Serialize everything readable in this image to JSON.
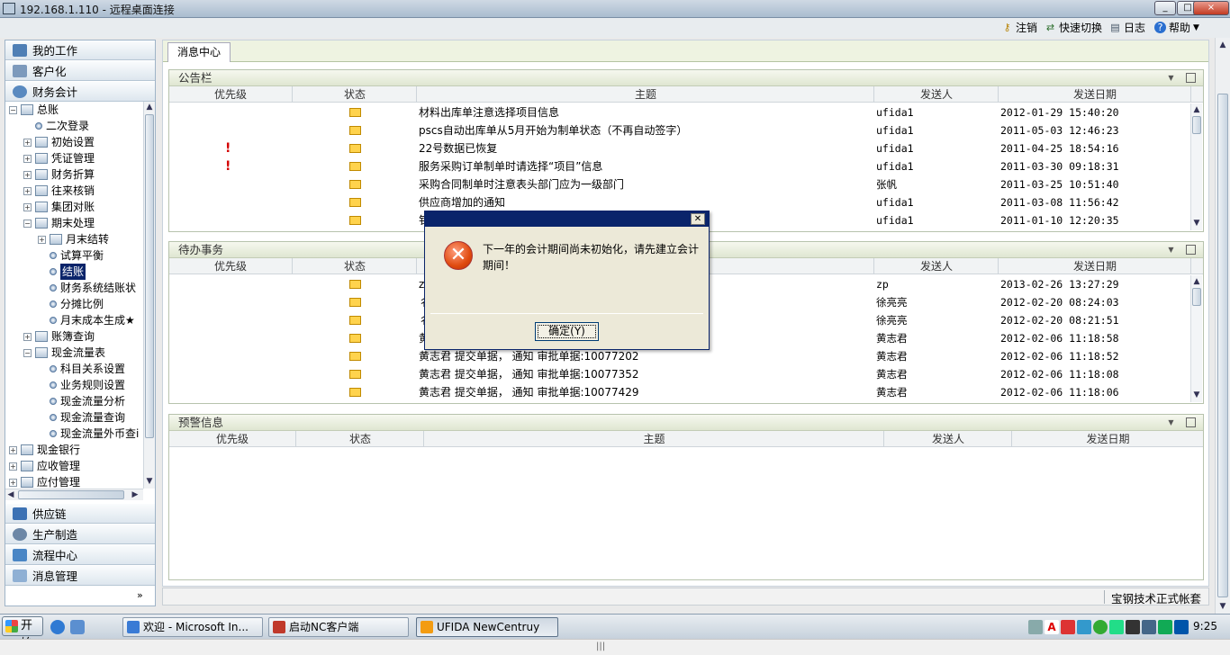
{
  "window": {
    "title": "192.168.1.110 - 远程桌面连接",
    "controls": [
      "_",
      "□",
      "×"
    ]
  },
  "toolbar": {
    "logout": "注销",
    "quick_switch": "快速切换",
    "log": "日志",
    "help": "帮助"
  },
  "nav": {
    "sections_top": [
      {
        "label": "我的工作",
        "icon": "computer-icon"
      },
      {
        "label": "客户化",
        "icon": "window-icon"
      },
      {
        "label": "财务会计",
        "icon": "person-icon"
      }
    ],
    "tree": [
      {
        "label": "总账",
        "level": 0,
        "expander": "−",
        "kind": "folder"
      },
      {
        "label": "二次登录",
        "level": 1,
        "expander": "",
        "kind": "leaf"
      },
      {
        "label": "初始设置",
        "level": 1,
        "expander": "+",
        "kind": "folder"
      },
      {
        "label": "凭证管理",
        "level": 1,
        "expander": "+",
        "kind": "folder"
      },
      {
        "label": "财务折算",
        "level": 1,
        "expander": "+",
        "kind": "folder"
      },
      {
        "label": "往来核销",
        "level": 1,
        "expander": "+",
        "kind": "folder"
      },
      {
        "label": "集团对账",
        "level": 1,
        "expander": "+",
        "kind": "folder"
      },
      {
        "label": "期末处理",
        "level": 1,
        "expander": "−",
        "kind": "folder"
      },
      {
        "label": "月末结转",
        "level": 2,
        "expander": "+",
        "kind": "folder"
      },
      {
        "label": "试算平衡",
        "level": 2,
        "expander": "",
        "kind": "leaf"
      },
      {
        "label": "结账",
        "level": 2,
        "expander": "",
        "kind": "leaf",
        "selected": true
      },
      {
        "label": "财务系统结账状",
        "level": 2,
        "expander": "",
        "kind": "leaf"
      },
      {
        "label": "分摊比例",
        "level": 2,
        "expander": "",
        "kind": "leaf"
      },
      {
        "label": "月末成本生成★",
        "level": 2,
        "expander": "",
        "kind": "leaf"
      },
      {
        "label": "账簿查询",
        "level": 1,
        "expander": "+",
        "kind": "folder"
      },
      {
        "label": "现金流量表",
        "level": 1,
        "expander": "−",
        "kind": "folder"
      },
      {
        "label": "科目关系设置",
        "level": 2,
        "expander": "",
        "kind": "leaf"
      },
      {
        "label": "业务规则设置",
        "level": 2,
        "expander": "",
        "kind": "leaf"
      },
      {
        "label": "现金流量分析",
        "level": 2,
        "expander": "",
        "kind": "leaf"
      },
      {
        "label": "现金流量查询",
        "level": 2,
        "expander": "",
        "kind": "leaf"
      },
      {
        "label": "现金流量外币查i",
        "level": 2,
        "expander": "",
        "kind": "leaf"
      },
      {
        "label": "现金银行",
        "level": 0,
        "expander": "+",
        "kind": "folder"
      },
      {
        "label": "应收管理",
        "level": 0,
        "expander": "+",
        "kind": "folder"
      },
      {
        "label": "应付管理",
        "level": 0,
        "expander": "+",
        "kind": "folder"
      }
    ],
    "sections_bottom": [
      {
        "label": "供应链",
        "icon": "supply-chain-icon"
      },
      {
        "label": "生产制造",
        "icon": "gear-icon"
      },
      {
        "label": "流程中心",
        "icon": "flow-icon"
      },
      {
        "label": "消息管理",
        "icon": "envelope-icon"
      }
    ],
    "collapse_glyph": "»"
  },
  "tab": {
    "label": "消息中心"
  },
  "columns": {
    "priority": "优先级",
    "status": "状态",
    "subject": "主题",
    "sender": "发送人",
    "date": "发送日期"
  },
  "bulletin": {
    "title": "公告栏",
    "rows": [
      {
        "priority": "",
        "subject": "材料出库单注意选择项目信息",
        "sender": "ufida1",
        "date": "2012-01-29 15:40:20"
      },
      {
        "priority": "",
        "subject": "pscs自动出库单从5月开始为制单状态（不再自动签字）",
        "sender": "ufida1",
        "date": "2011-05-03 12:46:23"
      },
      {
        "priority": "!",
        "subject": "22号数据已恢复",
        "sender": "ufida1",
        "date": "2011-04-25 18:54:16"
      },
      {
        "priority": "!",
        "subject": "服务采购订单制单时请选择“项目”信息",
        "sender": "ufida1",
        "date": "2011-03-30 09:18:31"
      },
      {
        "priority": "",
        "subject": "采购合同制单时注意表头部门应为一级部门",
        "sender": "张帆",
        "date": "2011-03-25 10:51:40"
      },
      {
        "priority": "",
        "subject": "供应商增加的通知",
        "sender": "ufida1",
        "date": "2011-03-08 11:56:42"
      },
      {
        "priority": "",
        "subject": "钅",
        "sender": "ufida1",
        "date": "2011-01-10 12:20:35"
      }
    ]
  },
  "todo": {
    "title": "待办事务",
    "rows": [
      {
        "priority": "",
        "subject": "z",
        "sender": "zp",
        "date": "2013-02-26 13:27:29"
      },
      {
        "priority": "",
        "subject": "彳",
        "sender": "徐亮亮",
        "date": "2012-02-20 08:24:03"
      },
      {
        "priority": "",
        "subject": "彳",
        "sender": "徐亮亮",
        "date": "2012-02-20 08:21:51"
      },
      {
        "priority": "",
        "subject": "黄",
        "sender": "黄志君",
        "date": "2012-02-06 11:18:58"
      },
      {
        "priority": "",
        "subject": "黄志君 提交单据， 通知 审批单据:10077202",
        "sender": "黄志君",
        "date": "2012-02-06 11:18:52"
      },
      {
        "priority": "",
        "subject": "黄志君 提交单据， 通知 审批单据:10077352",
        "sender": "黄志君",
        "date": "2012-02-06 11:18:08"
      },
      {
        "priority": "",
        "subject": "黄志君 提交单据， 通知 审批单据:10077429",
        "sender": "黄志君",
        "date": "2012-02-06 11:18:06"
      }
    ]
  },
  "warning": {
    "title": "预警信息",
    "rows": []
  },
  "status_bar": {
    "account": "宝钢技术正式帐套"
  },
  "dialog": {
    "close_glyph": "✕",
    "icon_glyph": "✕",
    "message": "下一年的会计期间尚未初始化，请先建立会计期间！",
    "ok_label": "确定(Y)"
  },
  "taskbar": {
    "start": "开始",
    "tasks": [
      {
        "label": "欢迎 - Microsoft In...",
        "icon_color": "#3a7bd5"
      },
      {
        "label": "启动NC客户端",
        "icon_color": "#c0392b"
      },
      {
        "label": "UFIDA NewCentruy",
        "icon_color": "#f39c12",
        "active": true
      }
    ],
    "clock": "9:25"
  },
  "colors": {
    "accent": "#0a246a",
    "panel_header": "#dfe6d1",
    "excl": "#d40000",
    "envelope": "#ffd34d"
  }
}
